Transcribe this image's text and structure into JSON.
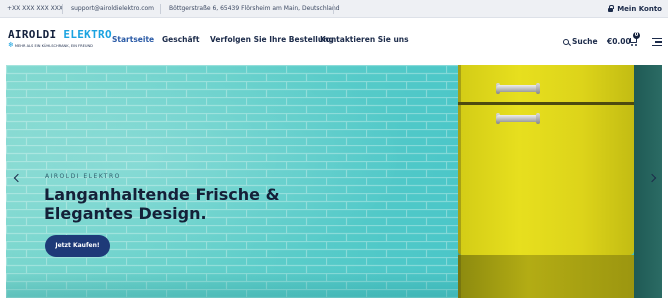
{
  "topbar": {
    "phone": "+XX XXX XXX XXX",
    "email": "support@airoldielektro.com",
    "address": "Böttgerstraße 6, 65439 Flörsheim am Main, Deutschland",
    "account_label": "Mein Konto"
  },
  "header": {
    "logo_part1": "AIROLDI",
    "logo_part2": "ELEKTRO",
    "logo_tagline": "MEHR ALS EIN KÜHLSCHRANK, EIN FREUND",
    "nav": [
      {
        "label": "Startseite",
        "active": true
      },
      {
        "label": "Geschäft",
        "active": false
      },
      {
        "label": "Verfolgen Sie Ihre Bestellung",
        "active": false
      },
      {
        "label": "Kontaktieren Sie uns",
        "active": false
      }
    ],
    "search_label": "Suche",
    "cart_total": "€0.00",
    "cart_count": "0"
  },
  "hero": {
    "eyebrow": "AIROLDI ELEKTRO",
    "headline_line1": "Langanhaltende Frische &",
    "headline_line2": "Elegantes Design.",
    "cta_label": "Jetzt Kaufen!"
  },
  "colors": {
    "accent": "#1aa3e0",
    "primary": "#1e3a78",
    "text": "#1c2b4a",
    "wall": "#4fc8c8",
    "fridge": "#e2da1c"
  },
  "icons": [
    "lock-icon",
    "snowflake-icon",
    "search-icon",
    "cart-icon",
    "menu-icon",
    "chevron-left-icon",
    "chevron-right-icon"
  ]
}
